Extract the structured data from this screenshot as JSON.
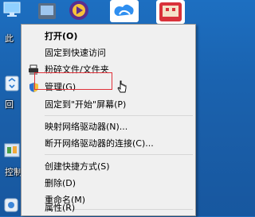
{
  "desktop": {
    "icons": [
      {
        "name": "this-pc",
        "label": "此"
      },
      {
        "name": "recycle-bin",
        "label": "回"
      },
      {
        "name": "control-panel",
        "label": "控制"
      }
    ]
  },
  "menu": {
    "items": [
      {
        "label": "打开(O)"
      },
      {
        "label": "固定到快速访问"
      },
      {
        "label": "粉碎文件/文件夹"
      },
      {
        "label": "管理(G)"
      },
      {
        "label": "固定到\"开始\"屏幕(P)"
      },
      {
        "label": "映射网络驱动器(N)..."
      },
      {
        "label": "断开网络驱动器的连接(C)..."
      },
      {
        "label": "创建快捷方式(S)"
      },
      {
        "label": "删除(D)"
      },
      {
        "label": "重命名(M)"
      },
      {
        "label": "属性(R)"
      }
    ]
  },
  "colors": {
    "desktop_bg": "#1a63b0",
    "menu_bg": "#f0f0f0",
    "highlight_border": "#e0323a"
  }
}
